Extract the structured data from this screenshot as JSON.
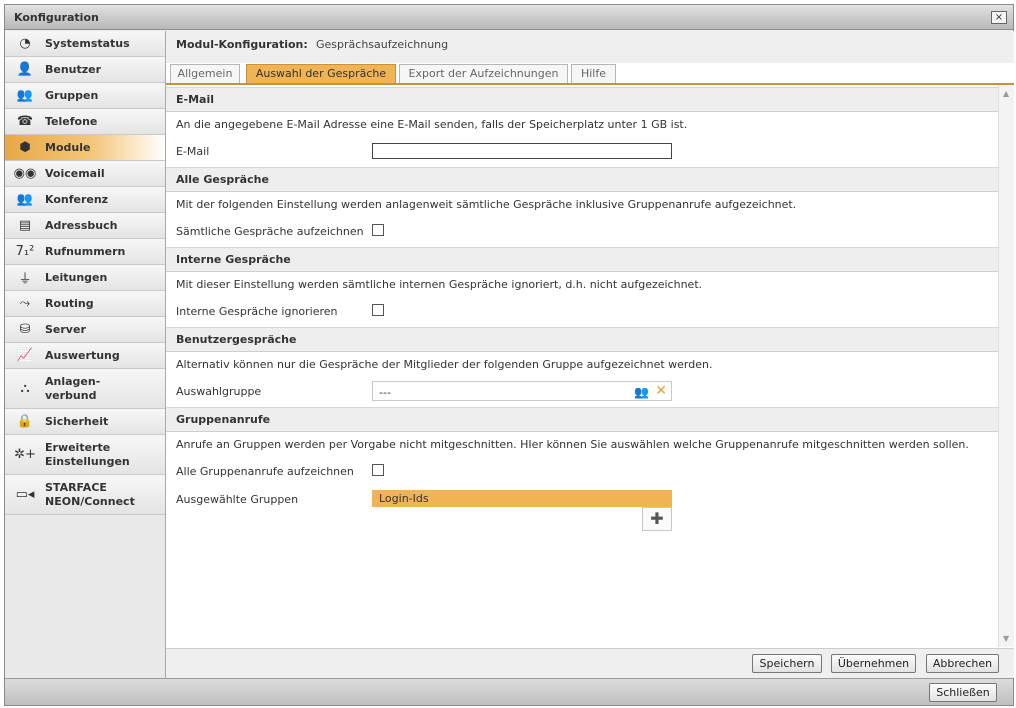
{
  "window": {
    "title": "Konfiguration",
    "close_symbol": "×"
  },
  "sidebar": {
    "items": [
      {
        "label": "Systemstatus",
        "icon": "pie-chart-icon",
        "glyph": "◔"
      },
      {
        "label": "Benutzer",
        "icon": "user-icon",
        "glyph": "👤"
      },
      {
        "label": "Gruppen",
        "icon": "group-icon",
        "glyph": "👥"
      },
      {
        "label": "Telefone",
        "icon": "telephone-icon",
        "glyph": "☎"
      },
      {
        "label": "Module",
        "icon": "cube-icon",
        "glyph": "⬢",
        "active": true
      },
      {
        "label": "Voicemail",
        "icon": "voicemail-icon",
        "glyph": "◉◉"
      },
      {
        "label": "Konferenz",
        "icon": "conference-icon",
        "glyph": "👥"
      },
      {
        "label": "Adressbuch",
        "icon": "address-book-icon",
        "glyph": "▤"
      },
      {
        "label": "Rufnummern",
        "icon": "numbers-icon",
        "glyph": "7₁²"
      },
      {
        "label": "Leitungen",
        "icon": "plug-icon",
        "glyph": "⏚"
      },
      {
        "label": "Routing",
        "icon": "routing-icon",
        "glyph": "⤳"
      },
      {
        "label": "Server",
        "icon": "server-icon",
        "glyph": "⛁"
      },
      {
        "label": "Auswertung",
        "icon": "line-chart-icon",
        "glyph": "📈"
      },
      {
        "label": "Anlagen-\nverbund",
        "icon": "network-icon",
        "glyph": "⛬"
      },
      {
        "label": "Sicherheit",
        "icon": "lock-icon",
        "glyph": "🔒"
      },
      {
        "label": "Erweiterte\nEinstellungen",
        "icon": "gear-plus-icon",
        "glyph": "✲+"
      },
      {
        "label": "STARFACE\nNEON/Connect",
        "icon": "video-camera-icon",
        "glyph": "▭◂"
      }
    ]
  },
  "module": {
    "key": "Modul-Konfiguration:",
    "value": "Gesprächsaufzeichnung"
  },
  "tabs": [
    {
      "label": "Allgemein"
    },
    {
      "label": "Auswahl der Gespräche",
      "active": true
    },
    {
      "label": "Export der Aufzeichnungen"
    },
    {
      "label": "Hilfe"
    }
  ],
  "sections": {
    "email": {
      "title": "E-Mail",
      "desc": "An die angegebene E-Mail Adresse eine E-Mail senden, falls der Speicherplatz unter 1 GB ist.",
      "field_label": "E-Mail",
      "value": ""
    },
    "all_calls": {
      "title": "Alle Gespräche",
      "desc": "Mit der folgenden Einstellung werden anlagenweit sämtliche Gespräche inklusive Gruppenanrufe aufgezeichnet.",
      "field_label": "Sämtliche Gespräche aufzeichnen",
      "checked": false
    },
    "internal_calls": {
      "title": "Interne Gespräche",
      "desc": "Mit dieser Einstellung werden sämtliche internen Gespräche ignoriert, d.h. nicht aufgezeichnet.",
      "field_label": "Interne Gespräche ignorieren",
      "checked": false
    },
    "user_calls": {
      "title": "Benutzergespräche",
      "desc": "Alternativ können nur die Gespräche der Mitglieder der folgenden Gruppe aufgezeichnet werden.",
      "field_label": "Auswahlgruppe",
      "value": "---"
    },
    "group_calls": {
      "title": "Gruppenanrufe",
      "desc": "Anrufe an Gruppen werden per Vorgabe nicht mitgeschnitten. HIer können Sie auswählen welche Gruppenanrufe mitgeschnitten werden sollen.",
      "all_label": "Alle Gruppenanrufe aufzeichnen",
      "all_checked": false,
      "selected_label": "Ausgewählte Gruppen",
      "selected_items": [
        "Login-Ids"
      ],
      "add_symbol": "✚"
    }
  },
  "footer": {
    "save": "Speichern",
    "apply": "Übernehmen",
    "cancel": "Abbrechen"
  },
  "bottom": {
    "close": "Schließen"
  },
  "colors": {
    "accent": "#f0b454",
    "accent_border": "#c8913a",
    "clear_icon": "#e8a230"
  }
}
